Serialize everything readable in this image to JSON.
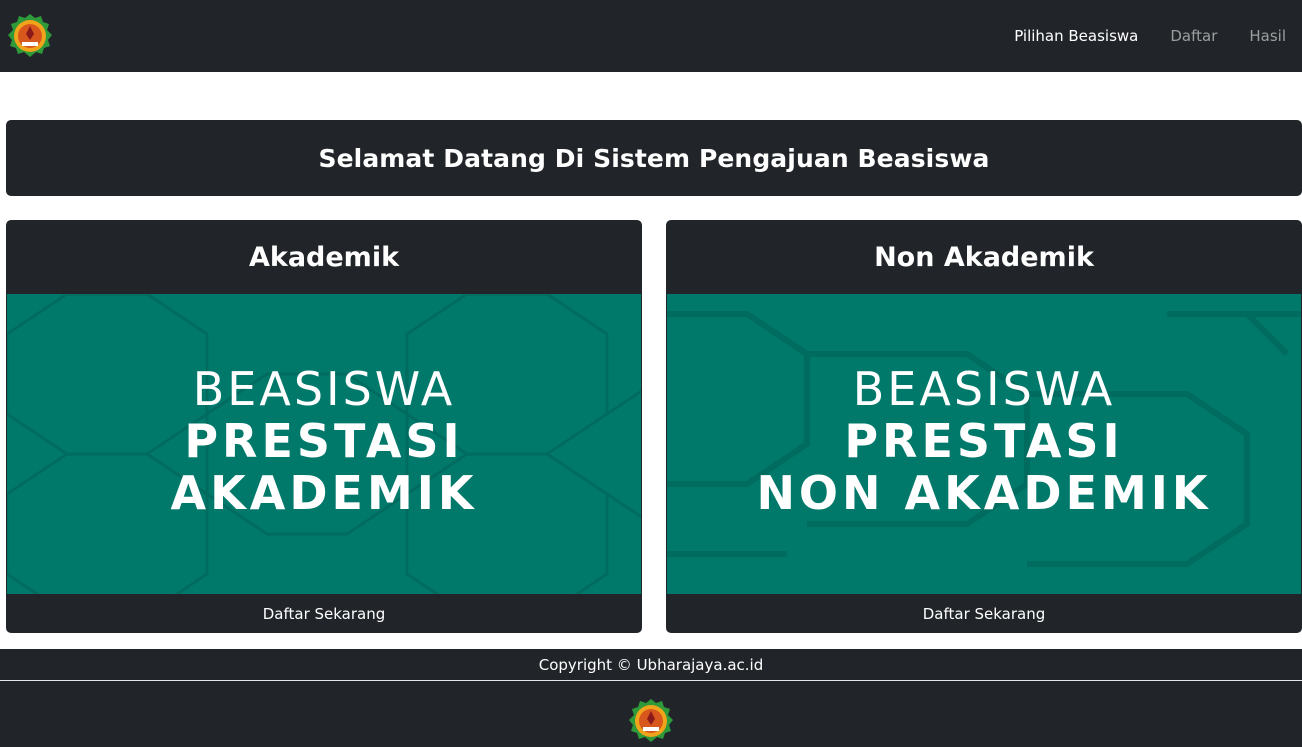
{
  "nav": {
    "logo_icon": "university-emblem-icon",
    "links": [
      {
        "label": "Pilihan Beasiswa",
        "active": true
      },
      {
        "label": "Daftar",
        "active": false
      },
      {
        "label": "Hasil",
        "active": false
      }
    ]
  },
  "welcome": {
    "title": "Selamat Datang Di Sistem Pengajuan Beasiswa"
  },
  "cards": [
    {
      "title": "Akademik",
      "image_lines": [
        "BEASISWA",
        "PRESTASI",
        "AKADEMIK"
      ],
      "footer": "Daftar Sekarang"
    },
    {
      "title": "Non Akademik",
      "image_lines": [
        "BEASISWA",
        "PRESTASI",
        "NON AKADEMIK"
      ],
      "footer": "Daftar Sekarang"
    }
  ],
  "footer": {
    "copyright": "Copyright © Ubharajaya.ac.id",
    "logo_icon": "university-emblem-icon"
  },
  "colors": {
    "dark": "#212529",
    "teal": "#00796b",
    "white": "#ffffff"
  }
}
